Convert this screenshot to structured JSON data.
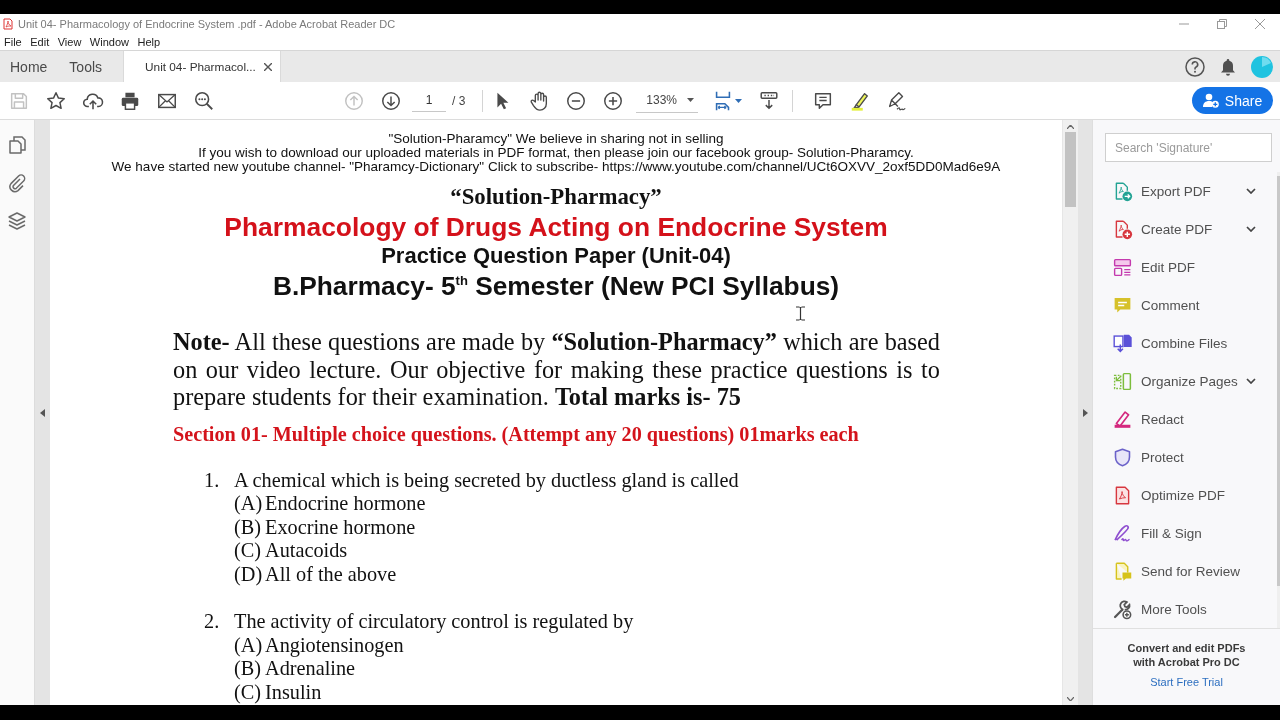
{
  "window": {
    "title": "Unit 04- Pharmacology of Endocrine System .pdf - Adobe Acrobat Reader DC"
  },
  "menu": [
    "File",
    "Edit",
    "View",
    "Window",
    "Help"
  ],
  "tabs": [
    {
      "label": "Home",
      "selected": false,
      "closable": false
    },
    {
      "label": "Tools",
      "selected": false,
      "closable": false
    },
    {
      "label": "Unit 04- Pharmacol...",
      "selected": true,
      "closable": true
    }
  ],
  "toolbar": {
    "save": {
      "disabled": true
    },
    "previous_page": {
      "disabled": true
    },
    "next_page": {
      "disabled": false
    },
    "page_number": "1",
    "page_total": "/ 3",
    "zoom": "133%",
    "share_button": "Share"
  },
  "document": {
    "header_lines": [
      "\"Solution-Pharamcy\" We believe in sharing not in selling",
      "If you wish to download our uploaded materials in PDF format, then please join our facebook group- Solution-Pharamcy.",
      "We have started new youtube channel- \"Pharamcy-Dictionary\" Click to subscribe- https://www.youtube.com/channel/UCt6OXVV_2oxf5DD0Mad6e9A"
    ],
    "brand": "“Solution-Pharmacy”",
    "title": "Pharmacology of Drugs Acting on Endocrine System",
    "subtitle": "Practice Question Paper (Unit-04)",
    "course": "B.Pharmacy- 5$^{th}$ Semester (New PCI Syllabus)",
    "note": "**Note-** All these questions are made by **“Solution-Pharmacy”** which are based on our video lecture. Our objective for making these practice questions is to prepare students for their examination. **Total marks is- 75**",
    "section": "Section 01- Multiple choice questions. (Attempt any 20 questions) 01marks each",
    "questions": [
      {
        "number": "1.",
        "text": "A chemical which is being secreted by ductless gland is called",
        "options": [
          {
            "letter": "(A)",
            "text": "Endocrine hormone"
          },
          {
            "letter": "(B)",
            "text": "Exocrine hormone"
          },
          {
            "letter": "(C)",
            "text": "Autacoids"
          },
          {
            "letter": "(D)",
            "text": "All of the above"
          }
        ]
      },
      {
        "number": "2.",
        "text": "The activity of circulatory control is regulated by",
        "options": [
          {
            "letter": "(A)",
            "text": "Angiotensinogen"
          },
          {
            "letter": "(B)",
            "text": "Adrenaline"
          },
          {
            "letter": "(C)",
            "text": "Insulin"
          }
        ]
      }
    ]
  },
  "tools_pane": {
    "search": {
      "placeholder": "Search 'Signature'"
    },
    "tools": [
      {
        "kind": "export",
        "label": "Export PDF",
        "has_menu": true
      },
      {
        "kind": "create",
        "label": "Create PDF",
        "has_menu": true
      },
      {
        "kind": "edit",
        "label": "Edit PDF",
        "has_menu": false
      },
      {
        "kind": "comment",
        "label": "Comment",
        "has_menu": false
      },
      {
        "kind": "combine",
        "label": "Combine Files",
        "has_menu": false
      },
      {
        "kind": "organize",
        "label": "Organize Pages",
        "has_menu": true
      },
      {
        "kind": "redact",
        "label": "Redact",
        "has_menu": false
      },
      {
        "kind": "protect",
        "label": "Protect",
        "has_menu": false
      },
      {
        "kind": "optimize",
        "label": "Optimize PDF",
        "has_menu": false
      },
      {
        "kind": "sign",
        "label": "Fill & Sign",
        "has_menu": false
      },
      {
        "kind": "review",
        "label": "Send for Review",
        "has_menu": false
      },
      {
        "kind": "more",
        "label": "More Tools",
        "has_menu": false
      }
    ],
    "promo": {
      "text": "Convert and edit PDFs with Acrobat Pro DC",
      "link": "Start Free Trial"
    }
  }
}
